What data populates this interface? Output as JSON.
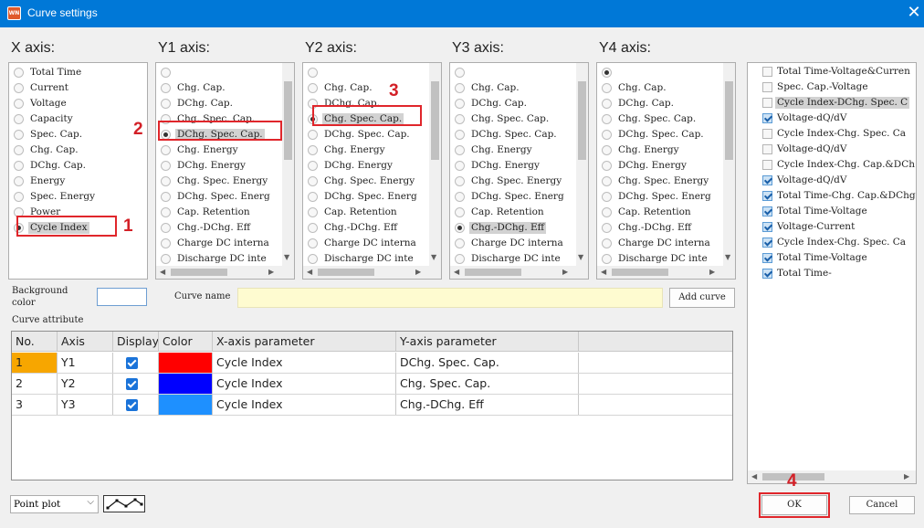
{
  "window": {
    "title": "Curve settings",
    "app_icon_text": "WN",
    "close_glyph": "✕"
  },
  "axes": [
    {
      "label": "X axis:"
    },
    {
      "label": "Y1 axis:"
    },
    {
      "label": "Y2 axis:"
    },
    {
      "label": "Y3 axis:"
    },
    {
      "label": "Y4 axis:"
    }
  ],
  "x_axis_options": [
    {
      "label": "Total Time",
      "selected": false
    },
    {
      "label": "Current",
      "selected": false
    },
    {
      "label": "Voltage",
      "selected": false
    },
    {
      "label": "Capacity",
      "selected": false
    },
    {
      "label": "Spec. Cap.",
      "selected": false
    },
    {
      "label": "Chg. Cap.",
      "selected": false
    },
    {
      "label": "DChg. Cap.",
      "selected": false
    },
    {
      "label": "Energy",
      "selected": false
    },
    {
      "label": "Spec. Energy",
      "selected": false
    },
    {
      "label": "Power",
      "selected": false
    },
    {
      "label": "Cycle Index",
      "selected": true
    }
  ],
  "y1_axis_options": [
    {
      "label": "",
      "selected": false
    },
    {
      "label": "Chg. Cap.",
      "selected": false
    },
    {
      "label": "DChg. Cap.",
      "selected": false
    },
    {
      "label": "Chg. Spec. Cap.",
      "selected": false
    },
    {
      "label": "DChg. Spec. Cap.",
      "selected": true
    },
    {
      "label": "Chg. Energy",
      "selected": false
    },
    {
      "label": "DChg. Energy",
      "selected": false
    },
    {
      "label": "Chg. Spec. Energy",
      "selected": false
    },
    {
      "label": "DChg. Spec. Energ",
      "selected": false
    },
    {
      "label": "Cap. Retention",
      "selected": false
    },
    {
      "label": "Chg.-DChg. Eff",
      "selected": false
    },
    {
      "label": "Charge DC interna",
      "selected": false
    },
    {
      "label": "Discharge DC inte",
      "selected": false
    }
  ],
  "y2_axis_options": [
    {
      "label": "",
      "selected": false
    },
    {
      "label": "Chg. Cap.",
      "selected": false
    },
    {
      "label": "DChg. Cap.",
      "selected": false
    },
    {
      "label": "Chg. Spec. Cap.",
      "selected": true
    },
    {
      "label": "DChg. Spec. Cap.",
      "selected": false
    },
    {
      "label": "Chg. Energy",
      "selected": false
    },
    {
      "label": "DChg. Energy",
      "selected": false
    },
    {
      "label": "Chg. Spec. Energy",
      "selected": false
    },
    {
      "label": "DChg. Spec. Energ",
      "selected": false
    },
    {
      "label": "Cap. Retention",
      "selected": false
    },
    {
      "label": "Chg.-DChg. Eff",
      "selected": false
    },
    {
      "label": "Charge DC interna",
      "selected": false
    },
    {
      "label": "Discharge DC inte",
      "selected": false
    }
  ],
  "y3_axis_options": [
    {
      "label": "",
      "selected": false
    },
    {
      "label": "Chg. Cap.",
      "selected": false
    },
    {
      "label": "DChg. Cap.",
      "selected": false
    },
    {
      "label": "Chg. Spec. Cap.",
      "selected": false
    },
    {
      "label": "DChg. Spec. Cap.",
      "selected": false
    },
    {
      "label": "Chg. Energy",
      "selected": false
    },
    {
      "label": "DChg. Energy",
      "selected": false
    },
    {
      "label": "Chg. Spec. Energy",
      "selected": false
    },
    {
      "label": "DChg. Spec. Energ",
      "selected": false
    },
    {
      "label": "Cap. Retention",
      "selected": false
    },
    {
      "label": "Chg.-DChg. Eff",
      "selected": true
    },
    {
      "label": "Charge DC interna",
      "selected": false
    },
    {
      "label": "Discharge DC inte",
      "selected": false
    }
  ],
  "y4_axis_options": [
    {
      "label": "",
      "selected": true
    },
    {
      "label": "Chg. Cap.",
      "selected": false
    },
    {
      "label": "DChg. Cap.",
      "selected": false
    },
    {
      "label": "Chg. Spec. Cap.",
      "selected": false
    },
    {
      "label": "DChg. Spec. Cap.",
      "selected": false
    },
    {
      "label": "Chg. Energy",
      "selected": false
    },
    {
      "label": "DChg. Energy",
      "selected": false
    },
    {
      "label": "Chg. Spec. Energy",
      "selected": false
    },
    {
      "label": "DChg. Spec. Energ",
      "selected": false
    },
    {
      "label": "Cap. Retention",
      "selected": false
    },
    {
      "label": "Chg.-DChg. Eff",
      "selected": false
    },
    {
      "label": "Charge DC interna",
      "selected": false
    },
    {
      "label": "Discharge DC inte",
      "selected": false
    }
  ],
  "saved_curves": [
    {
      "label": "Total Time-Voltage&Curren",
      "checked": false,
      "highlighted": false
    },
    {
      "label": "Spec. Cap.-Voltage",
      "checked": false,
      "highlighted": false
    },
    {
      "label": "Cycle Index-DChg. Spec. C",
      "checked": false,
      "highlighted": true
    },
    {
      "label": "Voltage-dQ/dV",
      "checked": true,
      "highlighted": false
    },
    {
      "label": "Cycle Index-Chg. Spec. Ca",
      "checked": false,
      "highlighted": false
    },
    {
      "label": "Voltage-dQ/dV",
      "checked": false,
      "highlighted": false
    },
    {
      "label": "Cycle Index-Chg. Cap.&DCh",
      "checked": false,
      "highlighted": false
    },
    {
      "label": "Voltage-dQ/dV",
      "checked": true,
      "highlighted": false
    },
    {
      "label": "Total Time-Chg. Cap.&DChg",
      "checked": true,
      "highlighted": false
    },
    {
      "label": "Total Time-Voltage",
      "checked": true,
      "highlighted": false
    },
    {
      "label": "Voltage-Current",
      "checked": true,
      "highlighted": false
    },
    {
      "label": "Cycle Index-Chg. Spec. Ca",
      "checked": true,
      "highlighted": false
    },
    {
      "label": "Total Time-Voltage",
      "checked": true,
      "highlighted": false
    },
    {
      "label": "Total Time-",
      "checked": true,
      "highlighted": false
    }
  ],
  "form": {
    "background_color_label_1": "Background",
    "background_color_label_2": "color",
    "curve_name_label": "Curve name",
    "curve_name_value": "",
    "add_curve_label": "Add curve",
    "curve_attribute_label": "Curve attribute"
  },
  "table": {
    "columns": [
      "No.",
      "Axis",
      "Display",
      "Color",
      "X-axis parameter",
      "Y-axis parameter"
    ],
    "rows": [
      {
        "no": "1",
        "axis": "Y1",
        "display": true,
        "color": "#ff0000",
        "x_param": "Cycle Index",
        "y_param": "DChg. Spec. Cap."
      },
      {
        "no": "2",
        "axis": "Y2",
        "display": true,
        "color": "#0000ff",
        "x_param": "Cycle Index",
        "y_param": "Chg. Spec. Cap."
      },
      {
        "no": "3",
        "axis": "Y3",
        "display": true,
        "color": "#1e90ff",
        "x_param": "Cycle Index",
        "y_param": "Chg.-DChg. Eff"
      }
    ],
    "active_cell_color": "#f7a600"
  },
  "footer": {
    "plot_type": "Point plot",
    "dropdown_chevron": "⌵",
    "ok_label": "OK",
    "cancel_label": "Cancel"
  },
  "annotations": {
    "step1": "1",
    "step2": "2",
    "step3": "3",
    "step4": "4",
    "highlight_color": "#e0262b"
  },
  "scroll_glyphs": {
    "up": "▲",
    "down": "▼",
    "left": "◀",
    "right": "▶"
  }
}
